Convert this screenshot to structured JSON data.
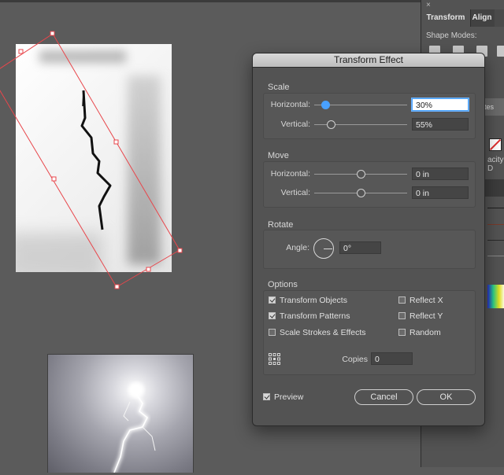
{
  "dialog": {
    "title": "Transform Effect",
    "scale": {
      "label": "Scale",
      "horizontal_label": "Horizontal:",
      "horizontal_value": "30%",
      "horizontal_fraction": 0.12,
      "vertical_label": "Vertical:",
      "vertical_value": "55%",
      "vertical_fraction": 0.18
    },
    "move": {
      "label": "Move",
      "horizontal_label": "Horizontal:",
      "horizontal_value": "0 in",
      "horizontal_fraction": 0.5,
      "vertical_label": "Vertical:",
      "vertical_value": "0 in",
      "vertical_fraction": 0.5
    },
    "rotate": {
      "label": "Rotate",
      "angle_label": "Angle:",
      "angle_value": "0°"
    },
    "options": {
      "label": "Options",
      "transform_objects": {
        "label": "Transform Objects",
        "checked": true
      },
      "transform_patterns": {
        "label": "Transform Patterns",
        "checked": true
      },
      "scale_strokes": {
        "label": "Scale Strokes & Effects",
        "checked": false
      },
      "reflect_x": {
        "label": "Reflect X",
        "checked": false
      },
      "reflect_y": {
        "label": "Reflect Y",
        "checked": false
      },
      "random": {
        "label": "Random",
        "checked": false
      },
      "copies_label": "Copies",
      "copies_value": "0"
    },
    "preview": {
      "label": "Preview",
      "checked": true
    },
    "cancel_label": "Cancel",
    "ok_label": "OK"
  },
  "side_panel": {
    "close_glyph": "×",
    "tabs": [
      "Transform",
      "Align"
    ],
    "shape_modes_label": "Shape Modes:",
    "attributes_fragment": "butes",
    "opacity_fragment": "acity: D"
  },
  "colors": {
    "accent": "#49a1ff",
    "selection": "#e8464b",
    "panel_bg": "#535353",
    "canvas_bg": "#5b5b5b"
  }
}
